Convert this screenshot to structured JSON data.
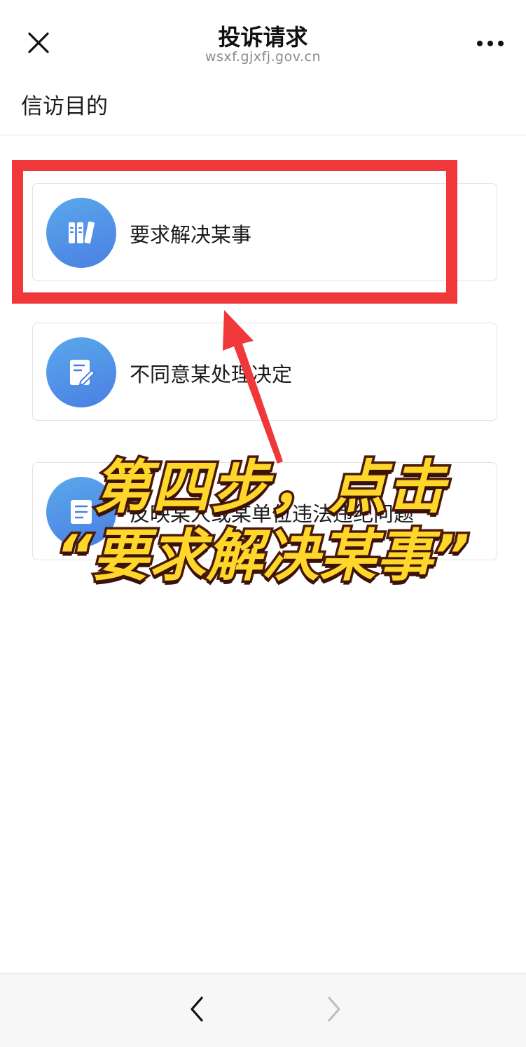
{
  "header": {
    "title": "投诉请求",
    "domain": "wsxf.gjxfj.gov.cn",
    "close_icon": "close-icon",
    "more_icon": "more-horizontal-icon"
  },
  "section": {
    "label": "信访目的"
  },
  "options": [
    {
      "label": "要求解决某事",
      "icon": "document-stack-icon"
    },
    {
      "label": "不同意某处理决定",
      "icon": "edit-document-icon"
    },
    {
      "label": "反映某人或某单位违法违纪问题",
      "icon": "report-icon"
    }
  ],
  "annotation": {
    "line1": "第四步，点击",
    "line2": "“要求解决某事”",
    "highlight_color": "#f0373a",
    "text_color": "#ffd62a"
  },
  "footer": {
    "back_icon": "chevron-left-icon",
    "forward_icon": "chevron-right-icon"
  },
  "colors": {
    "icon_gradient_start": "#5aa8ec",
    "icon_gradient_end": "#4a7fe2",
    "forward_disabled": "#bfbfbf"
  }
}
